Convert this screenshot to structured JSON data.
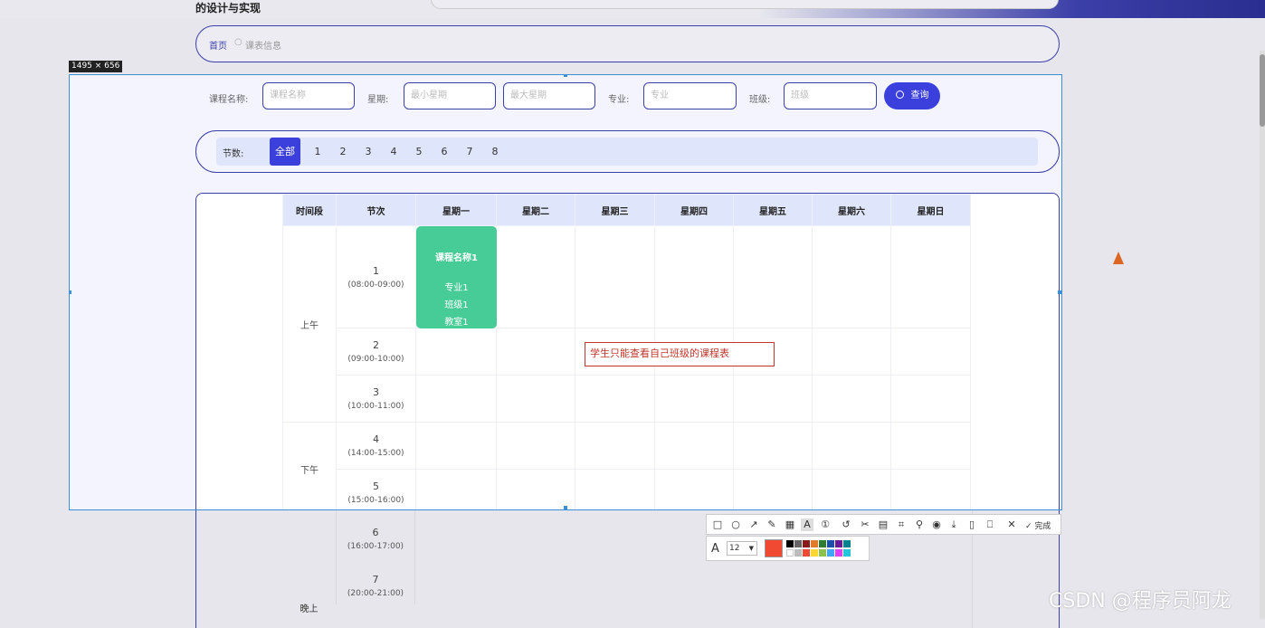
{
  "site_title": "的设计与实现",
  "breadcrumb": {
    "home": "首页",
    "sep": "○",
    "current": "课表信息"
  },
  "size_tag": "1495 × 656",
  "filters": {
    "course_label": "课程名称:",
    "course_placeholder": "课程名称",
    "week_label": "星期:",
    "week_min_placeholder": "最小星期",
    "week_max_placeholder": "最大星期",
    "major_label": "专业:",
    "major_placeholder": "专业",
    "class_label": "班级:",
    "class_placeholder": "班级",
    "search_button": "查询"
  },
  "sections": {
    "label": "节数:",
    "options": [
      "全部",
      "1",
      "2",
      "3",
      "4",
      "5",
      "6",
      "7",
      "8"
    ],
    "active": "全部"
  },
  "table": {
    "headers": [
      "时间段",
      "节次",
      "星期一",
      "星期二",
      "星期三",
      "星期四",
      "星期五",
      "星期六",
      "星期日"
    ],
    "periods": [
      "上午",
      "下午",
      "晚上"
    ],
    "slots": [
      {
        "num": "1",
        "time": "(08:00-09:00)"
      },
      {
        "num": "2",
        "time": "(09:00-10:00)"
      },
      {
        "num": "3",
        "time": "(10:00-11:00)"
      },
      {
        "num": "4",
        "time": "(14:00-15:00)"
      },
      {
        "num": "5",
        "time": "(15:00-16:00)"
      },
      {
        "num": "6",
        "time": "(16:00-17:00)"
      },
      {
        "num": "7",
        "time": "(20:00-21:00)"
      }
    ]
  },
  "course_card": {
    "name": "课程名称1",
    "major": "专业1",
    "class": "班级1",
    "room": "教室1",
    "color": "#48cc97"
  },
  "annotation": "学生只能查看自己班级的课程表",
  "toolbar": {
    "done_label": "完成",
    "font_size": "12",
    "accent": "#f04a32"
  },
  "watermark": "CSDN @程序员阿龙"
}
